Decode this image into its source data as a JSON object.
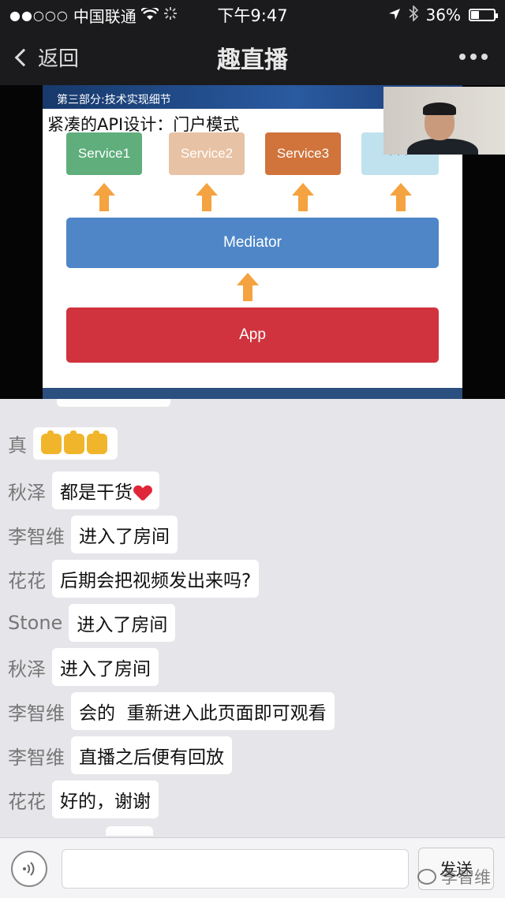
{
  "status_bar": {
    "carrier": "中国联通",
    "signal_dots": "●●○○○",
    "time": "下午9:47",
    "battery": "36%",
    "battery_level": 0.36
  },
  "nav": {
    "back_label": "返回",
    "title": "趣直播"
  },
  "slide": {
    "section": "第三部分:技术实现细节",
    "heading": "紧凑的API设计：门户模式",
    "services": [
      "Service1",
      "Service2",
      "Service3",
      "···"
    ],
    "service_colors": [
      "#5fae7c",
      "#e8c2a4",
      "#d0743c",
      "#bfe2ee"
    ],
    "mediator": "Mediator",
    "app": "App",
    "mediator_color": "#4e86c8",
    "app_color": "#d0333d",
    "arrow_color": "#f4a340"
  },
  "chat": {
    "messages": [
      {
        "name": "真",
        "text": ""
      },
      {
        "name": "秋泽",
        "text": "都是干货"
      },
      {
        "name": "李智维",
        "text": "进入了房间"
      },
      {
        "name": "花花",
        "text": "后期会把视频发出来吗?"
      },
      {
        "name": "Stone",
        "text": "进入了房间"
      },
      {
        "name": "秋泽",
        "text": "进入了房间"
      },
      {
        "name": "李智维",
        "text": "会的  重新进入此页面即可观看"
      },
      {
        "name": "李智维",
        "text": "直播之后便有回放"
      },
      {
        "name": "花花",
        "text": "好的，谢谢"
      }
    ]
  },
  "input": {
    "send_label": "发送",
    "watermark": "李智维"
  },
  "icons": [
    "wifi-icon",
    "loading-icon",
    "location-icon",
    "bluetooth-icon",
    "battery-icon",
    "back-chevron-icon",
    "more-icon",
    "voice-icon",
    "thumbs-up-icon",
    "heart-icon",
    "wechat-icon"
  ]
}
